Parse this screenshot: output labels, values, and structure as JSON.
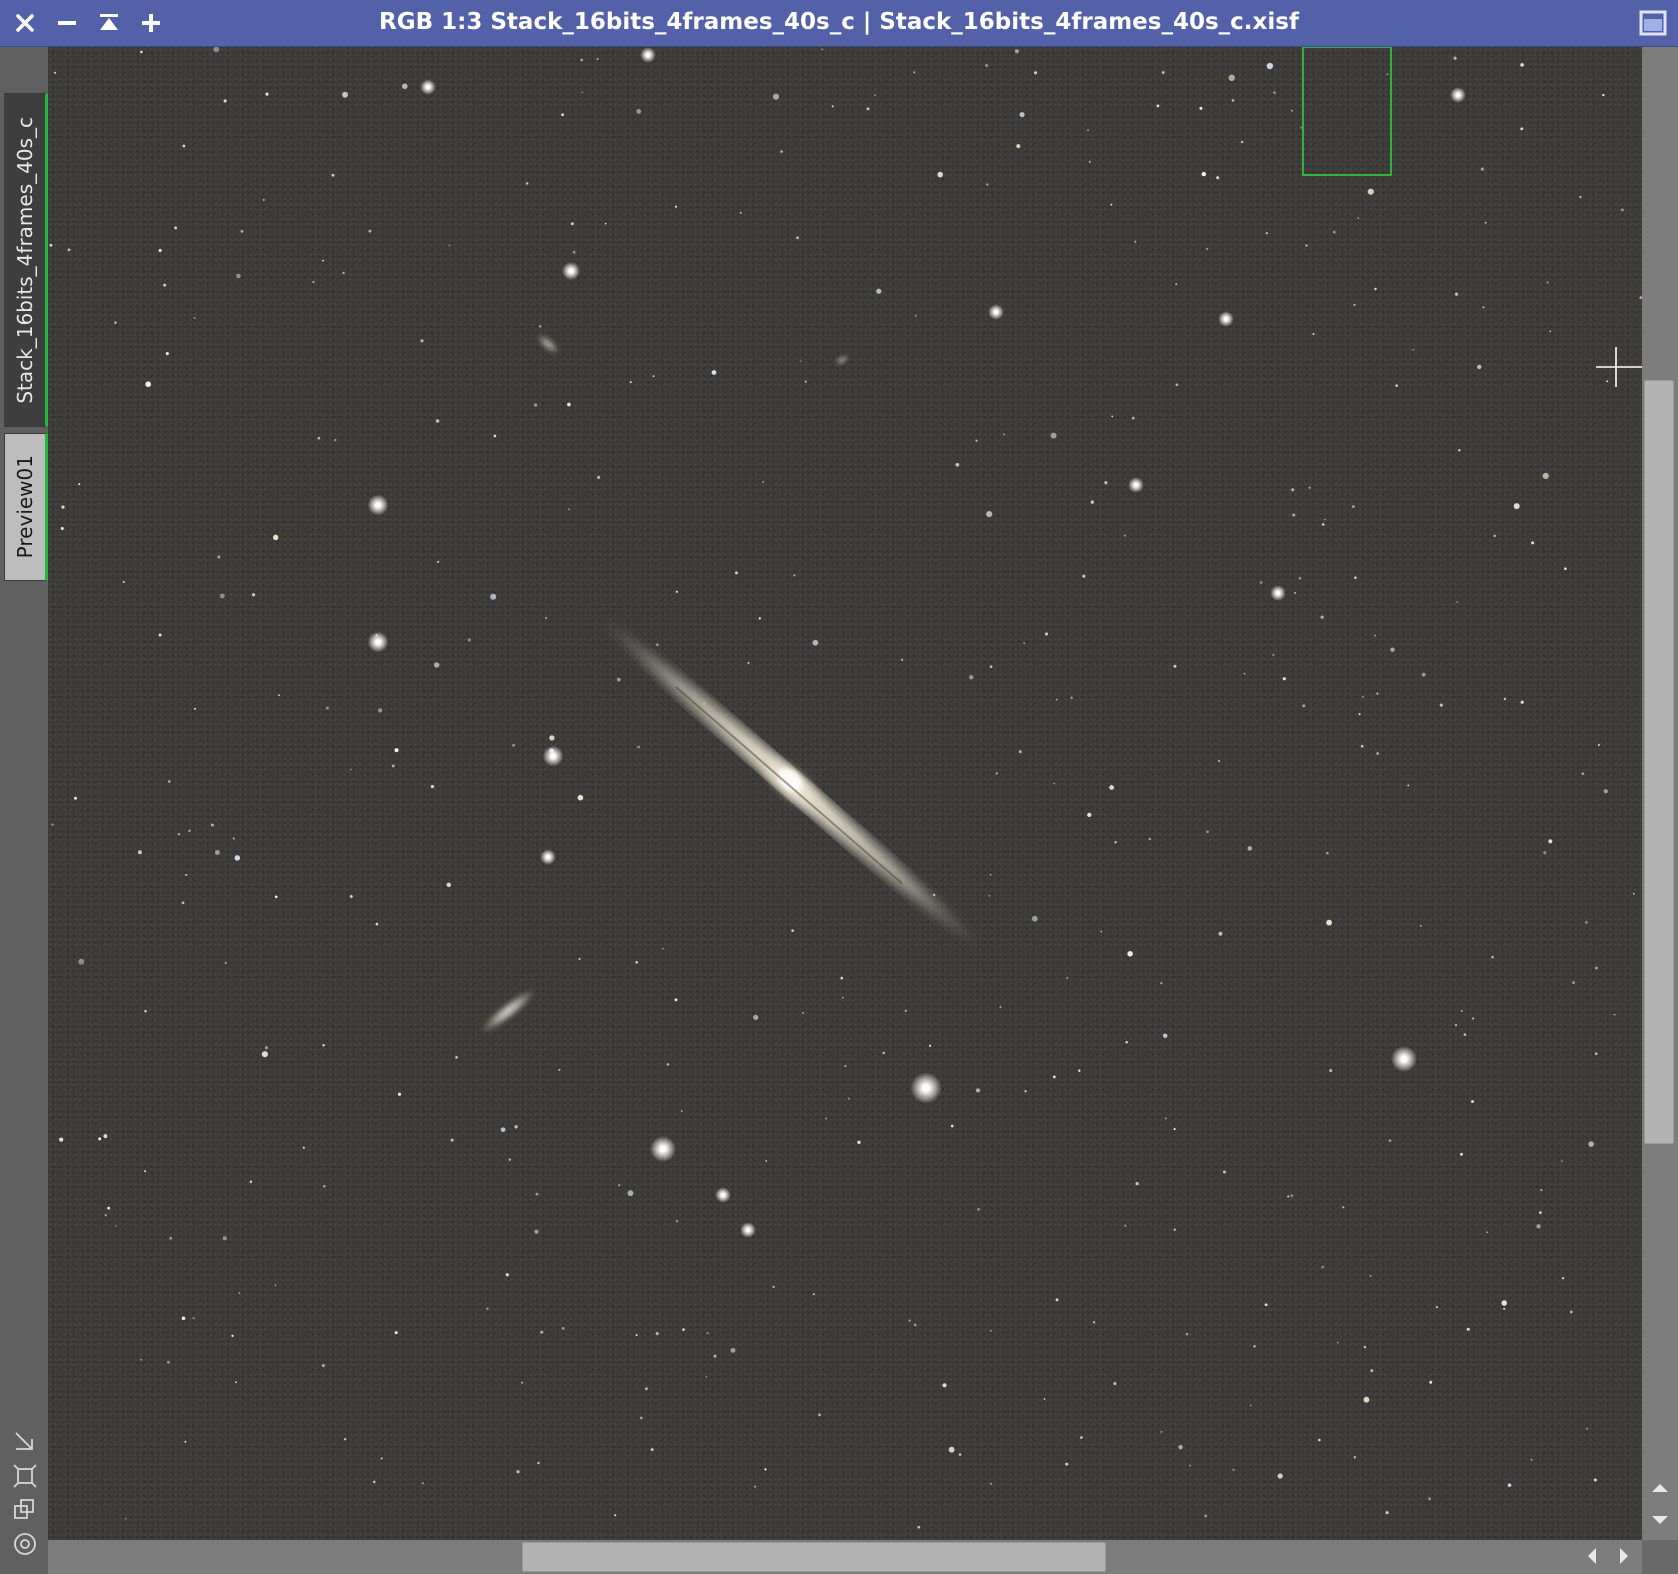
{
  "window": {
    "title": "RGB 1:3 Stack_16bits_4frames_40s_c | Stack_16bits_4frames_40s_c.xisf",
    "controls": [
      "close-icon",
      "minus-icon",
      "shade-icon",
      "plus-icon"
    ],
    "restore_icon": "window-restore-icon"
  },
  "tabs": [
    {
      "label": "Stack_16bits_4frames_40s_c",
      "active": true
    },
    {
      "label": "Preview01",
      "active": false
    }
  ],
  "sidebar_tools": [
    "zoom-to-fit-icon",
    "fit-view-icon",
    "clone-view-icon",
    "target-icon"
  ],
  "scroll": {
    "vertical_position": 0.22,
    "vertical_extent": 0.51,
    "horizontal_position": 0.3,
    "horizontal_extent": 0.37
  },
  "colors": {
    "titlebar": "#5361a8",
    "sky_background": "#3c3b38",
    "preview_outline": "#2fce3f",
    "active_tab_indicator": "#1fb83a"
  }
}
